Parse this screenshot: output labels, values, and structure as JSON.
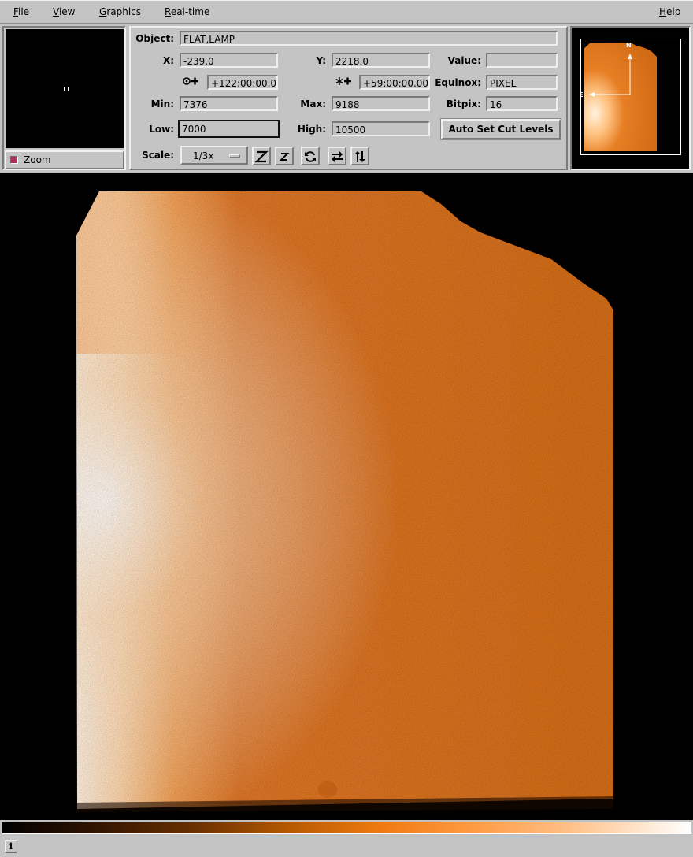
{
  "menu": {
    "file": {
      "initial": "F",
      "rest": "ile"
    },
    "view": {
      "initial": "V",
      "rest": "iew"
    },
    "graphics": {
      "initial": "G",
      "rest": "raphics"
    },
    "realtime": {
      "initial": "R",
      "rest": "eal-time"
    },
    "help": {
      "initial": "H",
      "rest": "elp"
    }
  },
  "zoom": {
    "label": "Zoom",
    "checked": true
  },
  "info": {
    "object_label": "Object:",
    "object_value": "FLAT,LAMP",
    "x_label": "X:",
    "x_value": "-239.0",
    "y_label": "Y:",
    "y_value": "2218.0",
    "value_label": "Value:",
    "value_value": "",
    "ra_value": "+122:00:00.000",
    "dec_value": "+59:00:00.00",
    "equinox_label": "Equinox:",
    "equinox_value": "PIXEL",
    "min_label": "Min:",
    "min_value": "7376",
    "max_label": "Max:",
    "max_value": "9188",
    "bitpix_label": "Bitpix:",
    "bitpix_value": "16",
    "low_label": "Low:",
    "low_value": "7000",
    "high_label": "High:",
    "high_value": "10500",
    "auto_cut_label": "Auto Set Cut Levels",
    "scale_label": "Scale:",
    "scale_value": "1/3x"
  },
  "toolbar": {
    "icons": [
      "zoom-in-icon",
      "zoom-out-icon",
      "rotate-icon",
      "flip-x-icon",
      "flip-y-icon"
    ]
  },
  "compass": {
    "north": "N",
    "east": "E"
  },
  "colors": {
    "panel_bg": "#c4c4c4",
    "image_orange": "#e07a20",
    "image_bright": "#ffe6cc",
    "accent_check": "#b0305a"
  },
  "status": {
    "icon": "i"
  }
}
